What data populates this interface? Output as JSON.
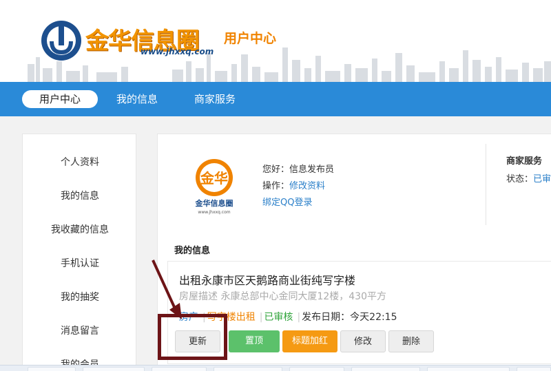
{
  "header": {
    "logo_text": "金华信息圈",
    "logo_url": "www.jhxxq.com",
    "title": "用户中心"
  },
  "nav": {
    "items": [
      {
        "label": "用户中心"
      },
      {
        "label": "我的信息"
      },
      {
        "label": "商家服务"
      }
    ]
  },
  "sidebar": {
    "items": [
      {
        "label": "个人资料"
      },
      {
        "label": "我的信息"
      },
      {
        "label": "我收藏的信息"
      },
      {
        "label": "手机认证"
      },
      {
        "label": "我的抽奖"
      },
      {
        "label": "消息留言"
      },
      {
        "label": "我的会员"
      }
    ]
  },
  "profile": {
    "avatar_text": "金华",
    "avatar_caption": "金华信息圈",
    "avatar_url": "www.jhxxq.com",
    "greeting": "您好：信息发布员",
    "operation_label": "操作：",
    "edit_link": "修改资料",
    "bind_qq": "绑定QQ登录"
  },
  "business": {
    "title": "商家服务",
    "status_label": "状态：",
    "status_value": "已审"
  },
  "my_info": {
    "title": "我的信息",
    "listing": {
      "title": "出租永康市区天鹅路商业街纯写字楼",
      "description": "房屋描述 永康总部中心金同大厦12楼，430平方",
      "category": "房产",
      "type": "写字楼出租",
      "status": "已审核",
      "date": "发布日期：今天22:15"
    },
    "buttons": {
      "refresh": "更新",
      "top": "置顶",
      "highlight": "标题加红",
      "edit": "修改",
      "delete": "删除"
    }
  },
  "colors": {
    "nav_blue": "#2a8ad8",
    "brand_orange": "#f08300",
    "link_blue": "#2a7fc9",
    "status_green": "#2fa33a",
    "annotation_red": "#6d1417"
  }
}
